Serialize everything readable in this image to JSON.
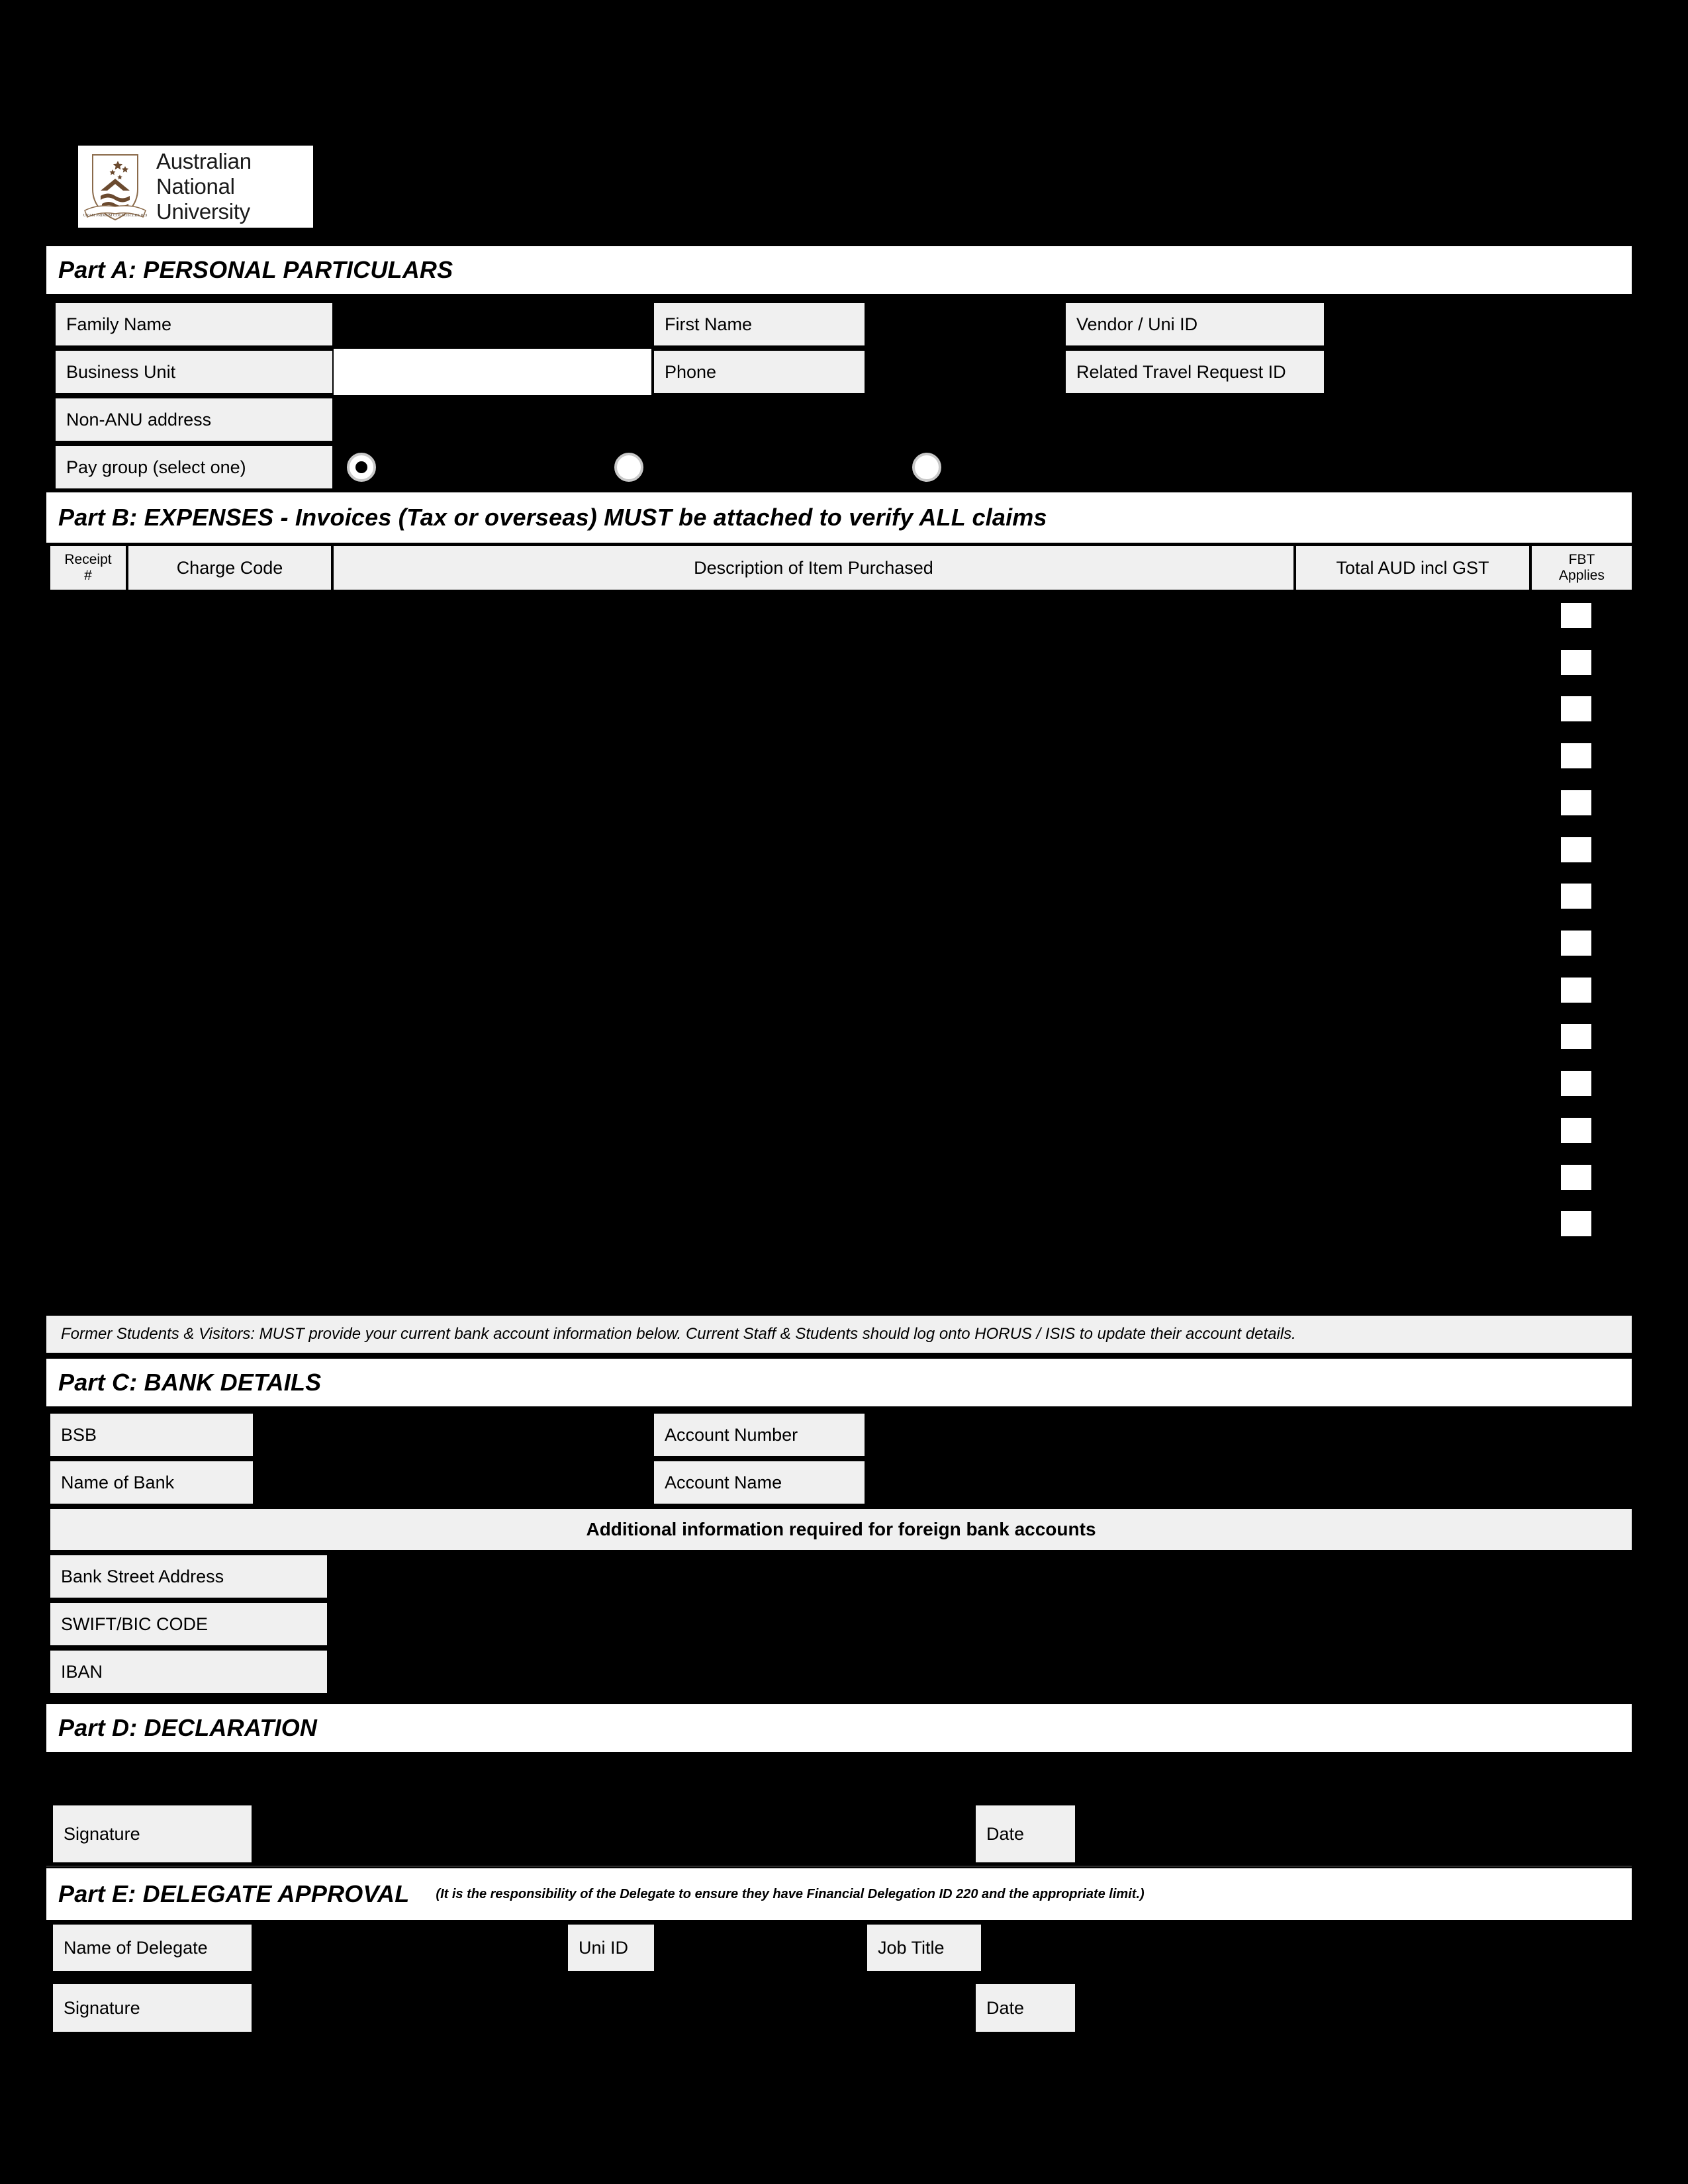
{
  "brand": {
    "logo_line1": "Australian",
    "logo_line2": "National",
    "logo_line3": "University",
    "crest_motto": "NATURAM PRIMUM COGNOSCERE RERUM",
    "accent_hex": "#6b4a2f",
    "page_bg_hex": "#000000",
    "label_bg_hex": "#f0f0f0",
    "field_bg_hex": "#ffffff"
  },
  "part_a": {
    "title": "Part A: PERSONAL PARTICULARS",
    "family_name_label": "Family Name",
    "family_name_value": "",
    "first_name_label": "First Name",
    "first_name_value": "",
    "vendor_uni_id_label": "Vendor  /  Uni ID",
    "vendor_uni_id_value": "",
    "business_unit_label": "Business Unit",
    "business_unit_value": "",
    "phone_label": "Phone",
    "phone_value": "",
    "related_travel_request_label": "Related Travel Request ID",
    "related_travel_request_value": "",
    "non_anu_address_label": "Non-ANU address",
    "non_anu_address_value": "",
    "pay_group_label": "Pay group (select one)",
    "pay_group_options": [
      {
        "label": "",
        "selected": true
      },
      {
        "label": "",
        "selected": false
      },
      {
        "label": "",
        "selected": false
      }
    ]
  },
  "part_b": {
    "title": "Part B: EXPENSES - Invoices (Tax or overseas) MUST be attached to verify ALL claims",
    "columns": [
      {
        "label": "Receipt\n#",
        "key": "receipt"
      },
      {
        "label": "Charge Code",
        "key": "charge_code"
      },
      {
        "label": "Description of Item Purchased",
        "key": "description"
      },
      {
        "label": "Total AUD incl GST",
        "key": "total"
      },
      {
        "label": "FBT\nApplies",
        "key": "fbt"
      }
    ],
    "column_header_receipt": "Receipt",
    "column_header_receipt_hash": "#",
    "column_header_charge_code": "Charge Code",
    "column_header_description": "Description of Item Purchased",
    "column_header_total": "Total AUD incl GST",
    "column_header_fbt_line1": "FBT",
    "column_header_fbt_line2": "Applies",
    "row_count": 14,
    "rows": [
      {
        "receipt": "",
        "charge_code": "",
        "description": "",
        "total": "",
        "fbt_checked": false
      },
      {
        "receipt": "",
        "charge_code": "",
        "description": "",
        "total": "",
        "fbt_checked": false
      },
      {
        "receipt": "",
        "charge_code": "",
        "description": "",
        "total": "",
        "fbt_checked": false
      },
      {
        "receipt": "",
        "charge_code": "",
        "description": "",
        "total": "",
        "fbt_checked": false
      },
      {
        "receipt": "",
        "charge_code": "",
        "description": "",
        "total": "",
        "fbt_checked": false
      },
      {
        "receipt": "",
        "charge_code": "",
        "description": "",
        "total": "",
        "fbt_checked": false
      },
      {
        "receipt": "",
        "charge_code": "",
        "description": "",
        "total": "",
        "fbt_checked": false
      },
      {
        "receipt": "",
        "charge_code": "",
        "description": "",
        "total": "",
        "fbt_checked": false
      },
      {
        "receipt": "",
        "charge_code": "",
        "description": "",
        "total": "",
        "fbt_checked": false
      },
      {
        "receipt": "",
        "charge_code": "",
        "description": "",
        "total": "",
        "fbt_checked": false
      },
      {
        "receipt": "",
        "charge_code": "",
        "description": "",
        "total": "",
        "fbt_checked": false
      },
      {
        "receipt": "",
        "charge_code": "",
        "description": "",
        "total": "",
        "fbt_checked": false
      },
      {
        "receipt": "",
        "charge_code": "",
        "description": "",
        "total": "",
        "fbt_checked": false
      },
      {
        "receipt": "",
        "charge_code": "",
        "description": "",
        "total": "",
        "fbt_checked": false
      }
    ]
  },
  "bank_note": "Former Students & Visitors: MUST provide your current bank account information below. Current Staff & Students should log onto HORUS / ISIS to update their account details.",
  "part_c": {
    "title": "Part C: BANK DETAILS",
    "bsb_label": "BSB",
    "bsb_value": "",
    "account_number_label": "Account Number",
    "account_number_value": "",
    "name_of_bank_label": "Name of Bank",
    "name_of_bank_value": "",
    "account_name_label": "Account Name",
    "account_name_value": "",
    "foreign_banner": "Additional information required for foreign bank accounts",
    "bank_street_address_label": "Bank Street Address",
    "bank_street_address_value": "",
    "swift_bic_label": "SWIFT/BIC CODE",
    "swift_bic_value": "",
    "iban_label": "IBAN",
    "iban_value": ""
  },
  "part_d": {
    "title": "Part D: DECLARATION",
    "signature_label": "Signature",
    "signature_value": "",
    "date_label": "Date",
    "date_value": ""
  },
  "part_e": {
    "title": "Part E: DELEGATE APPROVAL",
    "note": "(It is the responsibility of the Delegate to ensure they have Financial Delegation ID 220 and the appropriate limit.)",
    "name_of_delegate_label": "Name of Delegate",
    "name_of_delegate_value": "",
    "uni_id_label": "Uni ID",
    "uni_id_value": "",
    "job_title_label": "Job Title",
    "job_title_value": "",
    "signature_label": "Signature",
    "signature_value": "",
    "date_label": "Date",
    "date_value": ""
  }
}
